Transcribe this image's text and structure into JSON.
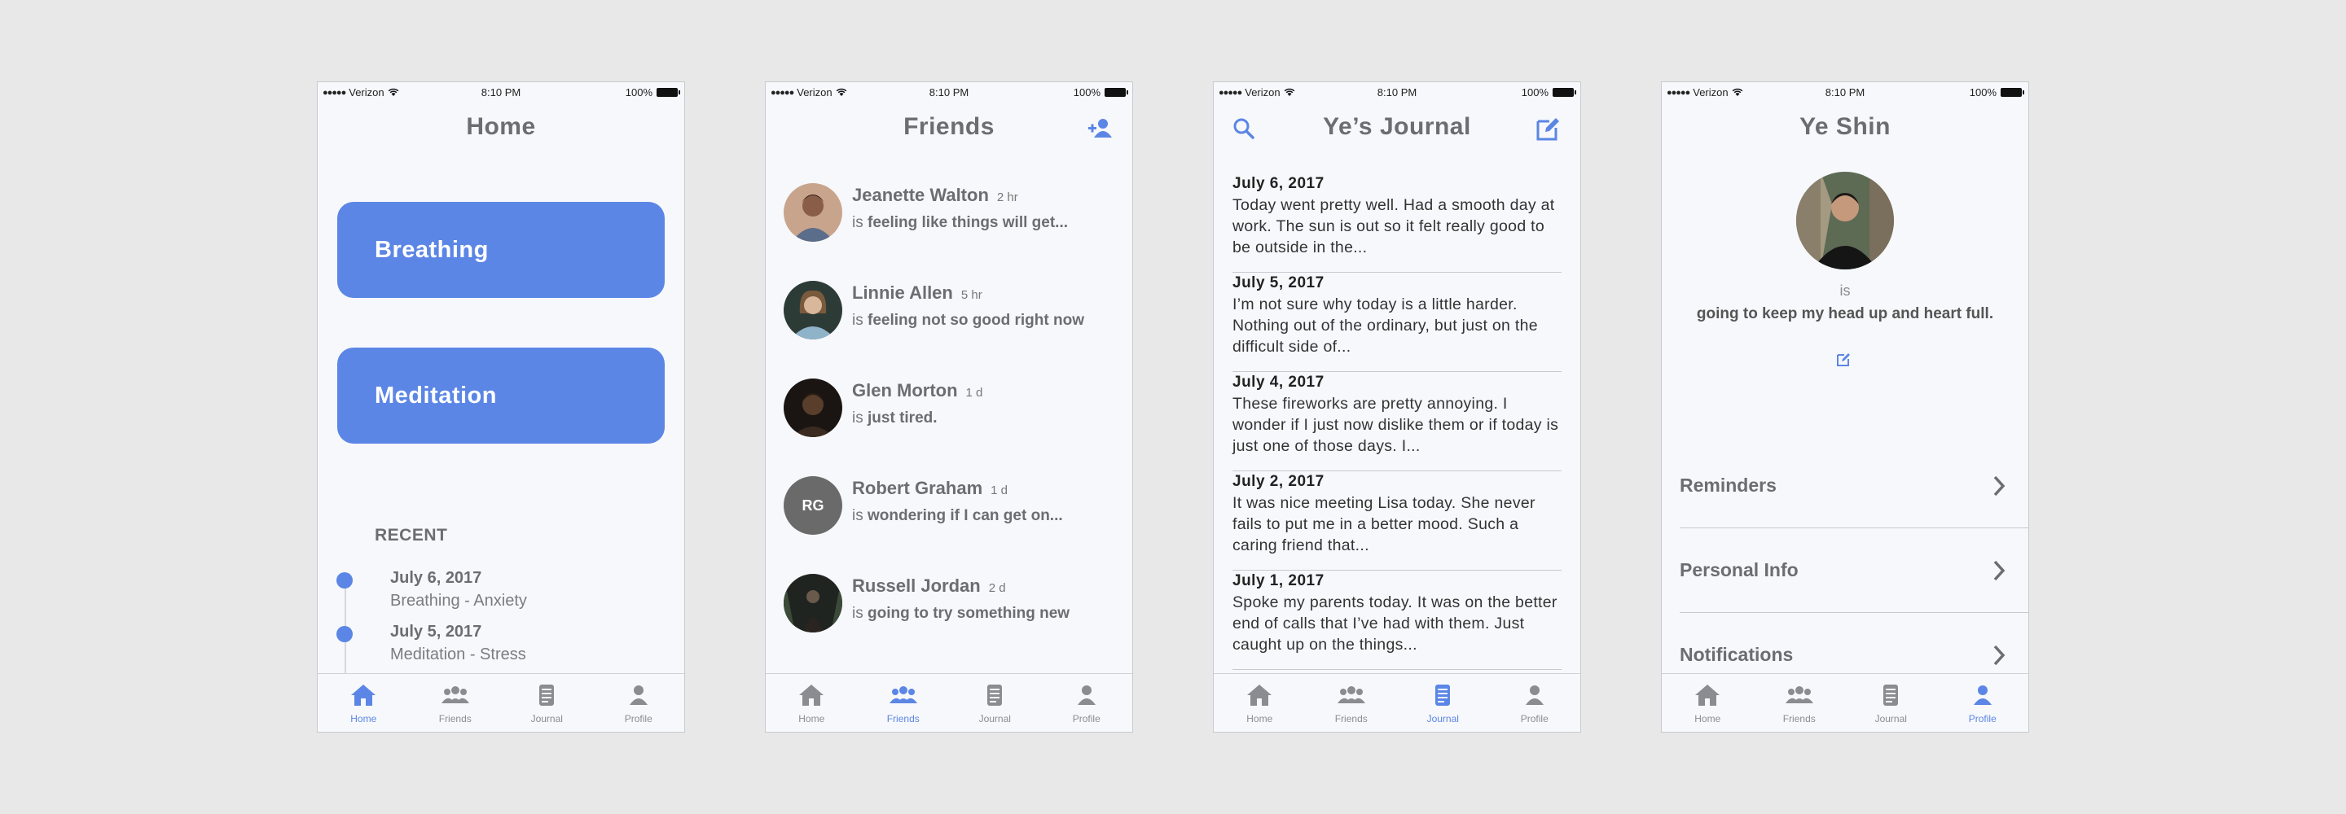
{
  "status_bar": {
    "carrier": "Verizon",
    "time": "8:10 PM",
    "battery": "100%"
  },
  "colors": {
    "accent": "#5b86e5",
    "background": "#f7f8fb",
    "canvas": "#e8e8e8"
  },
  "tabs": [
    {
      "label": "Home",
      "icon": "home-icon"
    },
    {
      "label": "Friends",
      "icon": "friends-icon"
    },
    {
      "label": "Journal",
      "icon": "journal-icon"
    },
    {
      "label": "Profile",
      "icon": "profile-icon"
    }
  ],
  "home": {
    "title": "Home",
    "buttons": [
      "Breathing",
      "Meditation"
    ],
    "recent_title": "RECENT",
    "recent": [
      {
        "date": "July 6, 2017",
        "desc": "Breathing - Anxiety"
      },
      {
        "date": "July 5, 2017",
        "desc": "Meditation - Stress"
      }
    ]
  },
  "friends": {
    "title": "Friends",
    "add_icon": "add-friend-icon",
    "items": [
      {
        "name": "Jeanette Walton",
        "time": "2 hr",
        "prefix": "is",
        "status": "feeling like things will get..."
      },
      {
        "name": "Linnie Allen",
        "time": "5 hr",
        "prefix": "is",
        "status": "feeling not so good right now"
      },
      {
        "name": "Glen Morton",
        "time": "1 d",
        "prefix": "is",
        "status": "just tired."
      },
      {
        "name": "Robert Graham",
        "time": "1 d",
        "prefix": "is",
        "status": "wondering if I can get on...",
        "initials": "RG"
      },
      {
        "name": "Russell Jordan",
        "time": "2 d",
        "prefix": "is",
        "status": "going to try something new"
      }
    ]
  },
  "journal": {
    "title": "Ye’s Journal",
    "entries": [
      {
        "date": "July 6, 2017",
        "text": "Today went pretty well. Had a smooth day at work. The sun is out so it felt really good to be outside in the..."
      },
      {
        "date": "July 5, 2017",
        "text": "I’m not sure why today is a little harder. Nothing out of the ordinary, but just on the difficult side of..."
      },
      {
        "date": "July 4, 2017",
        "text": "These fireworks are pretty annoying. I wonder if I just now dislike them or if today is just one of those days. I..."
      },
      {
        "date": "July 2, 2017",
        "text": "It was nice meeting Lisa today. She never fails to put me in a better mood. Such a caring friend that..."
      },
      {
        "date": "July 1, 2017",
        "text": "Spoke my parents today. It was on the better end of calls that I’ve had with them. Just caught up on the things..."
      }
    ]
  },
  "profile": {
    "title": "Ye Shin",
    "is_label": "is",
    "status": "going to keep my head up and heart full.",
    "menu": [
      "Reminders",
      "Personal Info",
      "Notifications"
    ]
  }
}
